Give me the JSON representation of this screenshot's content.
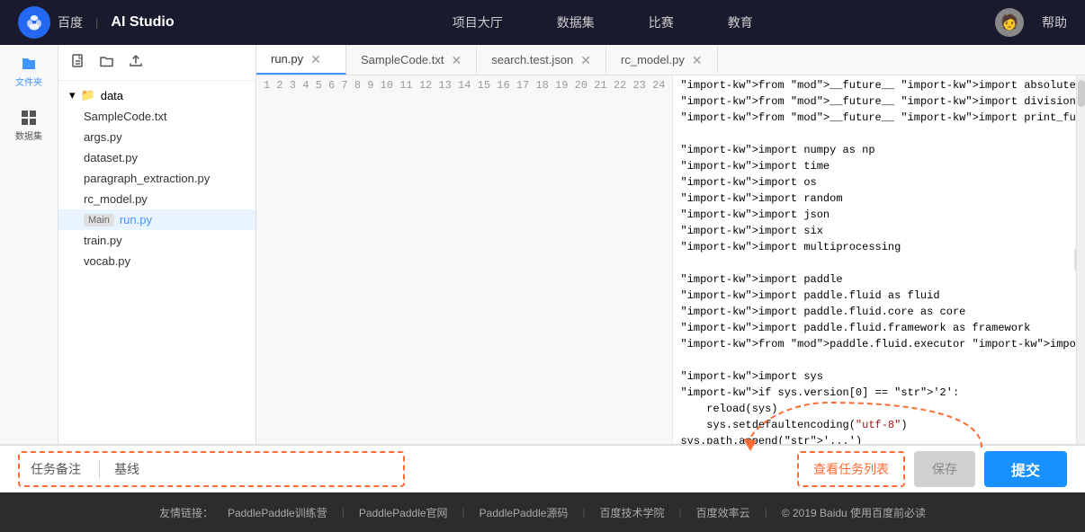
{
  "header": {
    "logo_text": "百度",
    "separator": "|",
    "studio_text": "AI Studio",
    "nav_items": [
      "项目大厅",
      "数据集",
      "比赛",
      "教育"
    ],
    "help": "帮助"
  },
  "sidebar": {
    "items": [
      {
        "label": "文件夹",
        "icon": "folder-icon"
      },
      {
        "label": "数据集",
        "icon": "dataset-icon"
      }
    ]
  },
  "file_panel": {
    "toolbar_icons": [
      "new-file-icon",
      "new-folder-icon",
      "upload-icon"
    ],
    "root_folder": "data",
    "files": [
      {
        "name": "SampleCode.txt",
        "active": false
      },
      {
        "name": "args.py",
        "active": false
      },
      {
        "name": "dataset.py",
        "active": false
      },
      {
        "name": "paragraph_extraction.py",
        "active": false
      },
      {
        "name": "rc_model.py",
        "active": false
      },
      {
        "name": "run.py",
        "badge": "Main",
        "active": true
      },
      {
        "name": "train.py",
        "active": false
      },
      {
        "name": "vocab.py",
        "active": false
      }
    ]
  },
  "tabs": [
    {
      "label": "run.py",
      "active": true,
      "closable": true
    },
    {
      "label": "SampleCode.txt",
      "active": false,
      "closable": true
    },
    {
      "label": "search.test.json",
      "active": false,
      "closable": true
    },
    {
      "label": "rc_model.py",
      "active": false,
      "closable": true
    }
  ],
  "code": {
    "lines": [
      {
        "num": 1,
        "content": "from __future__ import absolute_import"
      },
      {
        "num": 2,
        "content": "from __future__ import division"
      },
      {
        "num": 3,
        "content": "from __future__ import print_function"
      },
      {
        "num": 4,
        "content": ""
      },
      {
        "num": 5,
        "content": "import numpy as np"
      },
      {
        "num": 6,
        "content": "import time"
      },
      {
        "num": 7,
        "content": "import os"
      },
      {
        "num": 8,
        "content": "import random"
      },
      {
        "num": 9,
        "content": "import json"
      },
      {
        "num": 10,
        "content": "import six"
      },
      {
        "num": 11,
        "content": "import multiprocessing"
      },
      {
        "num": 12,
        "content": ""
      },
      {
        "num": 13,
        "content": "import paddle"
      },
      {
        "num": 14,
        "content": "import paddle.fluid as fluid"
      },
      {
        "num": 15,
        "content": "import paddle.fluid.core as core"
      },
      {
        "num": 16,
        "content": "import paddle.fluid.framework as framework"
      },
      {
        "num": 17,
        "content": "from paddle.fluid.executor import Executor"
      },
      {
        "num": 18,
        "content": ""
      },
      {
        "num": 19,
        "content": "import sys"
      },
      {
        "num": 20,
        "content": "if sys.version[0] == '2':"
      },
      {
        "num": 21,
        "content": "    reload(sys)"
      },
      {
        "num": 22,
        "content": "    sys.setdefaultencoding(\"utf-8\")"
      },
      {
        "num": 23,
        "content": "sys.path.append('...')"
      },
      {
        "num": 24,
        "content": ""
      }
    ]
  },
  "bottom_bar": {
    "task_note_label": "任务备注",
    "baseline_label": "基线",
    "view_tasks_label": "查看任务列表",
    "save_label": "保存",
    "submit_label": "提交"
  },
  "footer": {
    "prefix": "友情链接：",
    "links": [
      "PaddlePaddle训练营",
      "PaddlePaddle官网",
      "PaddlePaddle源码",
      "百度技术学院",
      "百度效率云"
    ],
    "copyright": "© 2019 Baidu 使用百度前必读"
  }
}
